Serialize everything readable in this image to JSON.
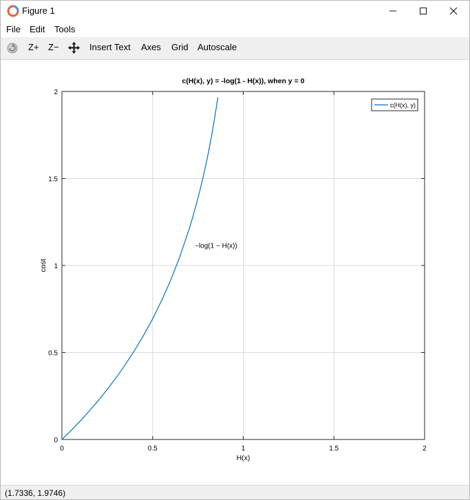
{
  "window": {
    "title": "Figure 1",
    "minimize_icon": "minimize-icon",
    "maximize_icon": "maximize-icon",
    "close_icon": "close-icon"
  },
  "menu": {
    "file": "File",
    "edit": "Edit",
    "tools": "Tools"
  },
  "toolbar": {
    "rotate_icon": "rotate-icon",
    "zoom_in": "Z+",
    "zoom_out": "Z−",
    "pan_icon": "pan-icon",
    "insert_text": "Insert Text",
    "axes": "Axes",
    "grid": "Grid",
    "autoscale": "Autoscale"
  },
  "status": {
    "coords": "(1.7336, 1.9746)"
  },
  "chart_data": {
    "type": "line",
    "title": "c(H(x), y) = -log(1 - H(x)), when y = 0",
    "xlabel": "H(x)",
    "ylabel": "cost",
    "xlim": [
      0,
      2
    ],
    "ylim": [
      0,
      2
    ],
    "x_ticks": [
      "0",
      "0.5",
      "1",
      "1.5",
      "2"
    ],
    "y_ticks": [
      "0",
      "0.5",
      "1",
      "1.5",
      "2"
    ],
    "grid": true,
    "legend_position": "top-right",
    "annotation": {
      "text": "−log(1 − H(x))",
      "x": 0.85,
      "y": 1.1
    },
    "series": [
      {
        "name": "c(H(x), y)",
        "color": "#0072bd",
        "x": [
          0,
          0.05,
          0.1,
          0.15,
          0.2,
          0.25,
          0.3,
          0.35,
          0.4,
          0.45,
          0.5,
          0.55,
          0.6,
          0.65,
          0.7,
          0.72,
          0.74,
          0.76,
          0.78,
          0.8,
          0.82,
          0.84,
          0.86
        ],
        "y": [
          0,
          0.051,
          0.105,
          0.163,
          0.223,
          0.288,
          0.357,
          0.431,
          0.511,
          0.598,
          0.693,
          0.799,
          0.916,
          1.05,
          1.204,
          1.273,
          1.347,
          1.427,
          1.514,
          1.609,
          1.715,
          1.833,
          1.966
        ]
      }
    ]
  }
}
